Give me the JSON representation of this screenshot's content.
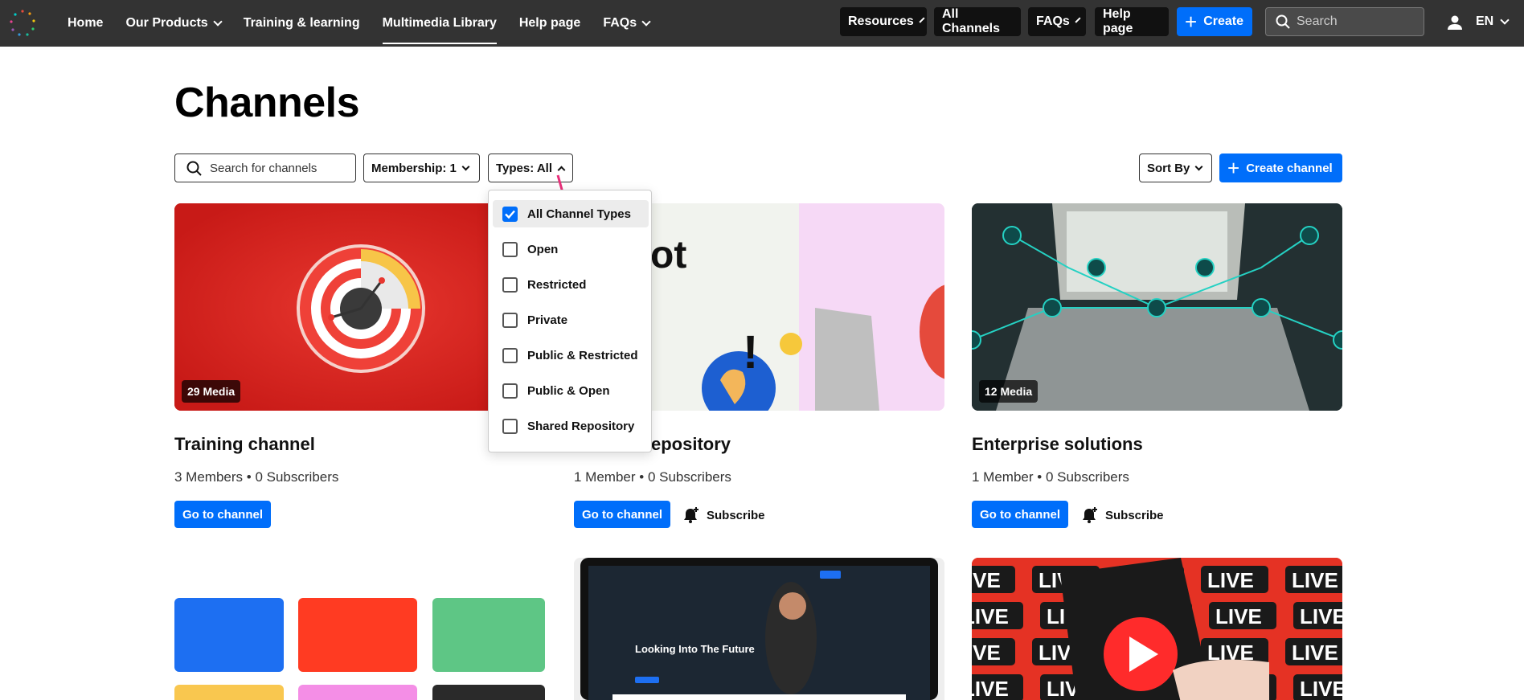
{
  "nav": {
    "items": [
      {
        "label": "Home",
        "dropdown": false
      },
      {
        "label": "Our Products",
        "dropdown": true
      },
      {
        "label": "Training & learning",
        "dropdown": false
      },
      {
        "label": "Multimedia Library",
        "dropdown": false,
        "active": true
      },
      {
        "label": "Help page",
        "dropdown": false
      },
      {
        "label": "FAQs",
        "dropdown": true
      }
    ],
    "right": {
      "resources": "Resources",
      "all_channels": "All Channels",
      "faqs": "FAQs",
      "help_page": "Help page",
      "create": "Create",
      "search_placeholder": "Search",
      "language": "EN"
    }
  },
  "page": {
    "title": "Channels",
    "search_placeholder": "Search for channels",
    "membership_filter": "Membership: 1",
    "types_filter": "Types: All",
    "sort_by": "Sort By",
    "create_channel": "Create channel"
  },
  "types_dropdown": {
    "options": [
      {
        "label": "All Channel Types",
        "checked": true
      },
      {
        "label": "Open",
        "checked": false
      },
      {
        "label": "Restricted",
        "checked": false
      },
      {
        "label": "Private",
        "checked": false
      },
      {
        "label": "Public & Restricted",
        "checked": false
      },
      {
        "label": "Public & Open",
        "checked": false
      },
      {
        "label": "Shared Repository",
        "checked": false
      }
    ]
  },
  "channels": [
    {
      "title": "Training channel",
      "members": "3 Members",
      "subscribers": "0 Subscribers",
      "media": "29 Media",
      "go": "Go to channel",
      "subscribe": ""
    },
    {
      "title": "epository",
      "members": "1 Member",
      "subscribers": "0 Subscribers",
      "media": "",
      "go": "Go to channel",
      "subscribe": "Subscribe"
    },
    {
      "title": "Enterprise solutions",
      "members": "1 Member",
      "subscribers": "0 Subscribers",
      "media": "12 Media",
      "go": "Go to channel",
      "subscribe": "Subscribe"
    }
  ],
  "thumb_text": {
    "partial": "ot",
    "video_heading": "Looking Into The Future",
    "live": "LIVE"
  },
  "colors": {
    "topbar": "#333333",
    "accent": "#006efa",
    "dark_pill": "#111111",
    "annotation_arrow": "#e8307a"
  }
}
